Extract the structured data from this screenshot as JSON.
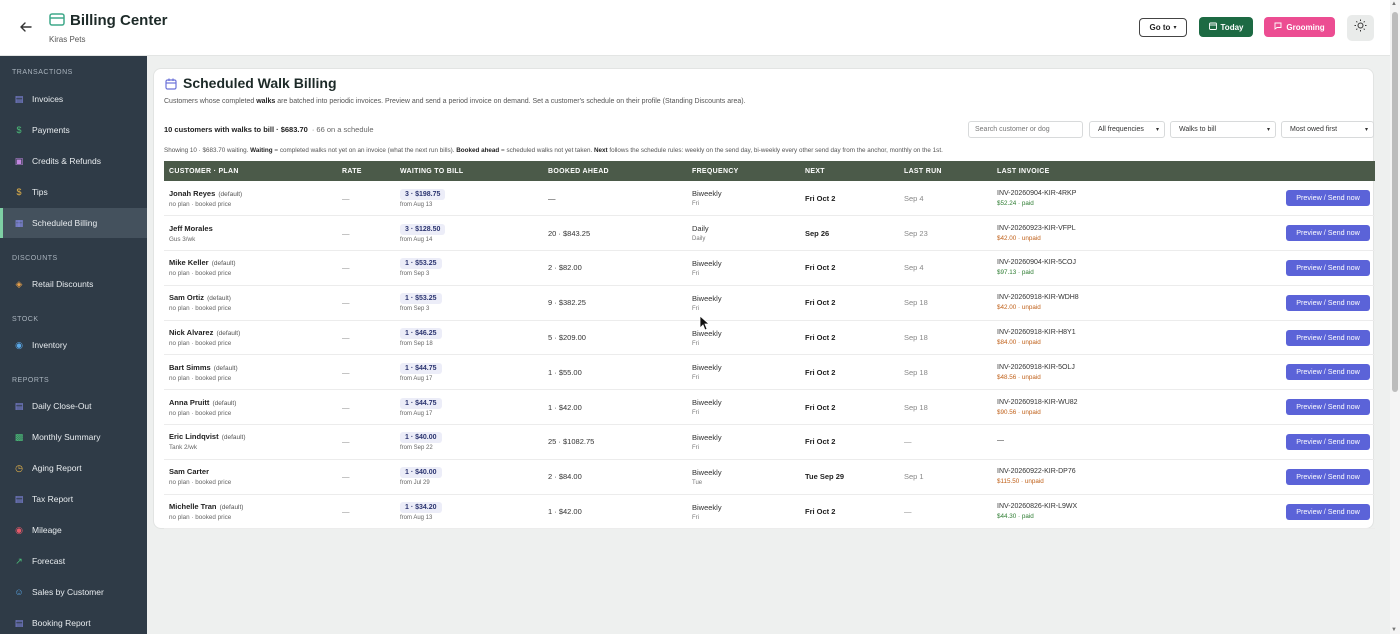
{
  "header": {
    "title": "Billing Center",
    "subtitle": "Kiras Pets",
    "goto_label": "Go to",
    "today_label": "Today",
    "grooming_label": "Grooming"
  },
  "sidebar": {
    "sections": [
      {
        "label": "TRANSACTIONS"
      },
      {
        "label": "DISCOUNTS"
      },
      {
        "label": "STOCK"
      },
      {
        "label": "REPORTS"
      }
    ],
    "items": [
      {
        "label": "Invoices",
        "icon": "document-icon",
        "color": "#8a8ff0"
      },
      {
        "label": "Payments",
        "icon": "dollar-icon",
        "color": "#4cc07a"
      },
      {
        "label": "Credits & Refunds",
        "icon": "gift-icon",
        "color": "#c387e0"
      },
      {
        "label": "Tips",
        "icon": "dollar-icon",
        "color": "#e8b54a"
      },
      {
        "label": "Scheduled Billing",
        "icon": "calendar-icon",
        "color": "#8a8ff0"
      },
      {
        "label": "Retail Discounts",
        "icon": "tag-icon",
        "color": "#e8a04a"
      },
      {
        "label": "Inventory",
        "icon": "globe-icon",
        "color": "#5aa8e8"
      },
      {
        "label": "Daily Close-Out",
        "icon": "clipboard-icon",
        "color": "#8a8ff0"
      },
      {
        "label": "Monthly Summary",
        "icon": "bar-chart-icon",
        "color": "#4cc07a"
      },
      {
        "label": "Aging Report",
        "icon": "clock-icon",
        "color": "#e8b54a"
      },
      {
        "label": "Tax Report",
        "icon": "receipt-icon",
        "color": "#8a8ff0"
      },
      {
        "label": "Mileage",
        "icon": "pin-icon",
        "color": "#e85a6a"
      },
      {
        "label": "Forecast",
        "icon": "trend-icon",
        "color": "#4cc07a"
      },
      {
        "label": "Sales by Customer",
        "icon": "users-icon",
        "color": "#5aa8e8"
      },
      {
        "label": "Booking Report",
        "icon": "book-icon",
        "color": "#8a8ff0"
      }
    ],
    "active_index": 4
  },
  "main": {
    "title": "Scheduled Walk Billing",
    "desc_pre": "Customers whose completed ",
    "desc_bold": "walks",
    "desc_post": " are batched into periodic invoices. Preview and send a period invoice on demand. Set a customer's schedule on their profile (Standing Discounts area).",
    "count_strong": "10 customers with walks to bill · $683.70",
    "count_muted": "· 66 on a schedule",
    "search_placeholder": "Search customer or dog",
    "filters": [
      "All frequencies",
      "Walks to bill",
      "Most owed first"
    ],
    "legend_1": "Showing 10 · $683.70 waiting. ",
    "legend_b1": "Waiting",
    "legend_2": " = completed walks not yet on an invoice (what the next run bills). ",
    "legend_b2": "Booked ahead",
    "legend_3": " = scheduled walks not yet taken. ",
    "legend_b3": "Next",
    "legend_4": " follows the schedule rules: weekly on the send day, bi-weekly every other send day from the anchor, monthly on the 1st.",
    "columns": [
      "CUSTOMER · PLAN",
      "RATE",
      "WAITING TO BILL",
      "BOOKED AHEAD",
      "FREQUENCY",
      "NEXT",
      "LAST RUN",
      "LAST INVOICE",
      ""
    ],
    "button_label": "Preview / Send now",
    "rows": [
      {
        "name": "Jonah Reyes",
        "default": "(default)",
        "plan": "no plan · booked price",
        "rate": "—",
        "waiting": "3 · $198.75",
        "from": "from Aug 13",
        "booked": "—",
        "freq": "Biweekly",
        "freq_day": "Fri",
        "next": "Fri Oct 2",
        "next_bold": true,
        "last_run": "Sep 4",
        "inv_id": "INV-20260904-KIR-4RKP",
        "inv_status": "$52.24 · paid",
        "paid": true
      },
      {
        "name": "Jeff Morales",
        "default": "",
        "plan": "Gus 3/wk",
        "rate": "—",
        "waiting": "3 · $128.50",
        "from": "from Aug 14",
        "booked": "20 · $843.25",
        "freq": "Daily",
        "freq_day": "Daily",
        "next": "Sep 26",
        "next_bold": true,
        "last_run": "Sep 23",
        "inv_id": "INV-20260923-KIR-VFPL",
        "inv_status": "$42.00 · unpaid",
        "paid": false
      },
      {
        "name": "Mike Keller",
        "default": "(default)",
        "plan": "no plan · booked price",
        "rate": "—",
        "waiting": "1 · $53.25",
        "from": "from Sep 3",
        "booked": "2 · $82.00",
        "freq": "Biweekly",
        "freq_day": "Fri",
        "next": "Fri Oct 2",
        "next_bold": true,
        "last_run": "Sep 4",
        "inv_id": "INV-20260904-KIR-5COJ",
        "inv_status": "$97.13 · paid",
        "paid": true
      },
      {
        "name": "Sam Ortiz",
        "default": "(default)",
        "plan": "no plan · booked price",
        "rate": "—",
        "waiting": "1 · $53.25",
        "from": "from Sep 3",
        "booked": "9 · $382.25",
        "freq": "Biweekly",
        "freq_day": "Fri",
        "next": "Fri Oct 2",
        "next_bold": true,
        "last_run": "Sep 18",
        "inv_id": "INV-20260918-KIR-WDH8",
        "inv_status": "$42.00 · unpaid",
        "paid": false
      },
      {
        "name": "Nick Alvarez",
        "default": "(default)",
        "plan": "no plan · booked price",
        "rate": "—",
        "waiting": "1 · $46.25",
        "from": "from Sep 18",
        "booked": "5 · $209.00",
        "freq": "Biweekly",
        "freq_day": "Fri",
        "next": "Fri Oct 2",
        "next_bold": true,
        "last_run": "Sep 18",
        "inv_id": "INV-20260918-KIR-H8Y1",
        "inv_status": "$84.00 · unpaid",
        "paid": false
      },
      {
        "name": "Bart Simms",
        "default": "(default)",
        "plan": "no plan · booked price",
        "rate": "—",
        "waiting": "1 · $44.75",
        "from": "from Aug 17",
        "booked": "1 · $55.00",
        "freq": "Biweekly",
        "freq_day": "Fri",
        "next": "Fri Oct 2",
        "next_bold": true,
        "last_run": "Sep 18",
        "inv_id": "INV-20260918-KIR-5OLJ",
        "inv_status": "$48.56 · unpaid",
        "paid": false
      },
      {
        "name": "Anna Pruitt",
        "default": "(default)",
        "plan": "no plan · booked price",
        "rate": "—",
        "waiting": "1 · $44.75",
        "from": "from Aug 17",
        "booked": "1 · $42.00",
        "freq": "Biweekly",
        "freq_day": "Fri",
        "next": "Fri Oct 2",
        "next_bold": true,
        "last_run": "Sep 18",
        "inv_id": "INV-20260918-KIR-WU82",
        "inv_status": "$90.56 · unpaid",
        "paid": false
      },
      {
        "name": "Eric Lindqvist",
        "default": "(default)",
        "plan": "Tank 2/wk",
        "rate": "—",
        "waiting": "1 · $40.00",
        "from": "from Sep 22",
        "booked": "25 · $1082.75",
        "freq": "Biweekly",
        "freq_day": "Fri",
        "next": "Fri Oct 2",
        "next_bold": true,
        "last_run": "—",
        "inv_id": "—",
        "inv_status": "",
        "paid": true
      },
      {
        "name": "Sam Carter",
        "default": "",
        "plan": "no plan · booked price",
        "rate": "—",
        "waiting": "1 · $40.00",
        "from": "from Jul 29",
        "booked": "2 · $84.00",
        "freq": "Biweekly",
        "freq_day": "Tue",
        "next": "Tue Sep 29",
        "next_bold": true,
        "last_run": "Sep 1",
        "inv_id": "INV-20260922-KIR-DP76",
        "inv_status": "$115.50 · unpaid",
        "paid": false
      },
      {
        "name": "Michelle Tran",
        "default": "(default)",
        "plan": "no plan · booked price",
        "rate": "—",
        "waiting": "1 · $34.20",
        "from": "from Aug 13",
        "booked": "1 · $42.00",
        "freq": "Biweekly",
        "freq_day": "Fri",
        "next": "Fri Oct 2",
        "next_bold": true,
        "last_run": "—",
        "inv_id": "INV-20260826-KIR-L9WX",
        "inv_status": "$44.30 · paid",
        "paid": true
      }
    ]
  },
  "colors": {
    "sidebar_bg": "#2f3b47",
    "table_header": "#4b5a49",
    "primary_button": "#5b63d8",
    "today_button": "#1d6a43",
    "grooming_button": "#ec4d92",
    "paid": "#2e7d32",
    "unpaid": "#c0611a"
  }
}
